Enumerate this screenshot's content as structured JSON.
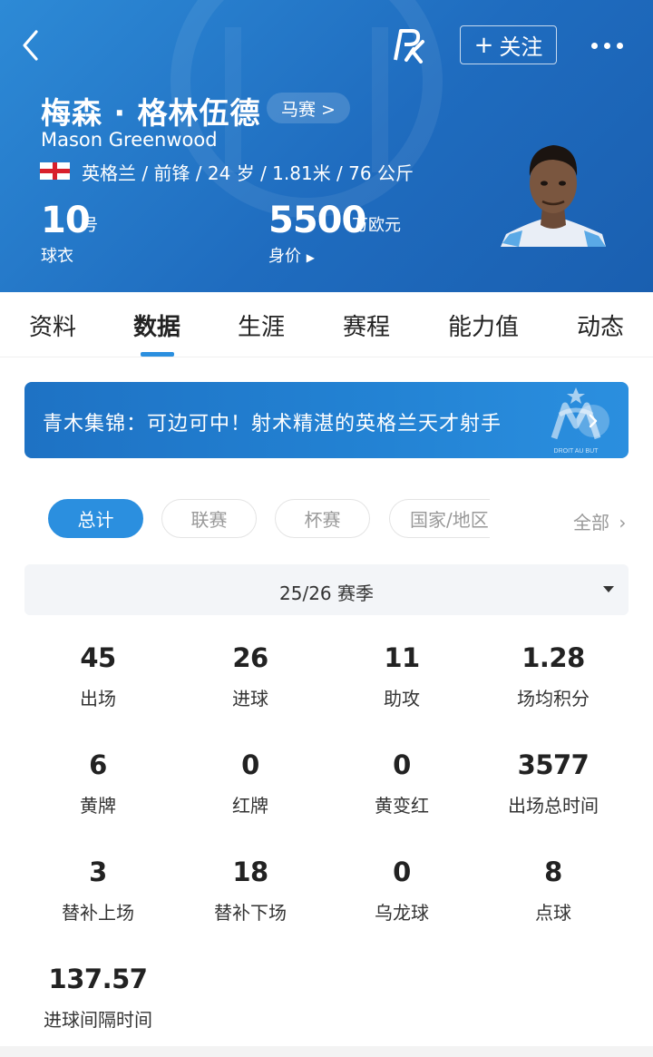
{
  "header": {
    "follow_label": "关注",
    "name_cn": "梅森 · 格林伍德",
    "club_label": "马赛 >",
    "name_en": "Mason Greenwood",
    "info_line": "英格兰 / 前锋 / 24 岁 / 1.81米 / 76 公斤",
    "shirt_number": "10",
    "shirt_unit": "号",
    "shirt_label": "球衣",
    "value_number": "5500",
    "value_unit": "万欧元",
    "value_label": "身价",
    "accent_color": "#2b8fdf"
  },
  "tabs": [
    {
      "label": "资料"
    },
    {
      "label": "数据"
    },
    {
      "label": "生涯"
    },
    {
      "label": "赛程"
    },
    {
      "label": "能力值"
    },
    {
      "label": "动态"
    }
  ],
  "banner": {
    "text": "青木集锦：可边可中！射术精湛的英格兰天才射手",
    "badge_text": "DROIT AU BUT"
  },
  "filters": [
    {
      "label": "总计",
      "active": true
    },
    {
      "label": "联赛",
      "active": false
    },
    {
      "label": "杯赛",
      "active": false
    },
    {
      "label": "国家/地区",
      "active": false
    }
  ],
  "all_label": "全部",
  "season_label": "25/26 赛季",
  "stats": [
    {
      "value": "45",
      "label": "出场"
    },
    {
      "value": "26",
      "label": "进球"
    },
    {
      "value": "11",
      "label": "助攻"
    },
    {
      "value": "1.28",
      "label": "场均积分"
    },
    {
      "value": "6",
      "label": "黄牌"
    },
    {
      "value": "0",
      "label": "红牌"
    },
    {
      "value": "0",
      "label": "黄变红"
    },
    {
      "value": "3577",
      "label": "出场总时间"
    },
    {
      "value": "3",
      "label": "替补上场"
    },
    {
      "value": "18",
      "label": "替补下场"
    },
    {
      "value": "0",
      "label": "乌龙球"
    },
    {
      "value": "8",
      "label": "点球"
    },
    {
      "value": "137.57",
      "label": "进球间隔时间"
    }
  ]
}
